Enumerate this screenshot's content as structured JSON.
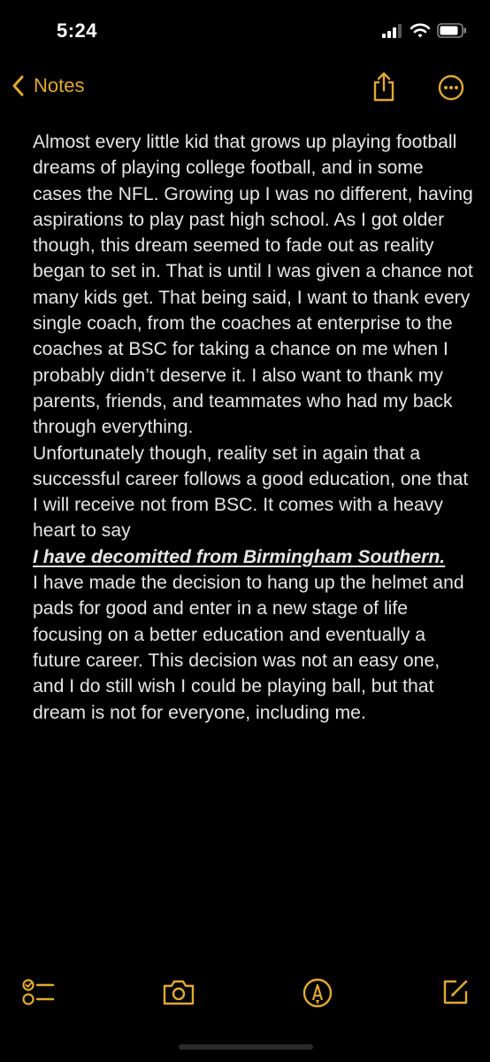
{
  "status_bar": {
    "time": "5:24"
  },
  "nav": {
    "back_label": "Notes"
  },
  "note": {
    "intro": "Almost every little kid that grows up playing football dreams of playing college football, and in some cases the NFL. Growing up I was no different, having aspirations to play past high school. As I got older though, this dream seemed to fade out as reality began to set in. That is until I was given a chance not many kids get. That being said, I want to thank every single coach, from the coaches at enterprise to the coaches at BSC for taking a chance on me when I probably didn’t deserve it. I also want to thank my parents, friends, and teammates who had my back through everything.",
    "middle": "Unfortunately though, reality set in again that a successful career follows a good education, one that I will receive not from BSC. It comes with a heavy heart to say",
    "emphasis": "I have decomitted from Birmingham Southern.",
    "closing": "I have made the decision to hang up the helmet and pads for good and enter in a new stage of life focusing on a better education and eventually a future career. This decision was not an easy one, and I do still wish I could be playing ball, but that dream is not for everyone, including me."
  },
  "colors": {
    "accent": "#e3a92c",
    "background": "#000000",
    "text": "#e6e6e6"
  },
  "icons": {
    "status": [
      "signal-icon",
      "wifi-icon",
      "battery-icon"
    ],
    "nav": [
      "chevron-left-icon",
      "share-icon",
      "more-icon"
    ],
    "toolbar": [
      "checklist-icon",
      "camera-icon",
      "markup-icon",
      "compose-icon"
    ]
  }
}
